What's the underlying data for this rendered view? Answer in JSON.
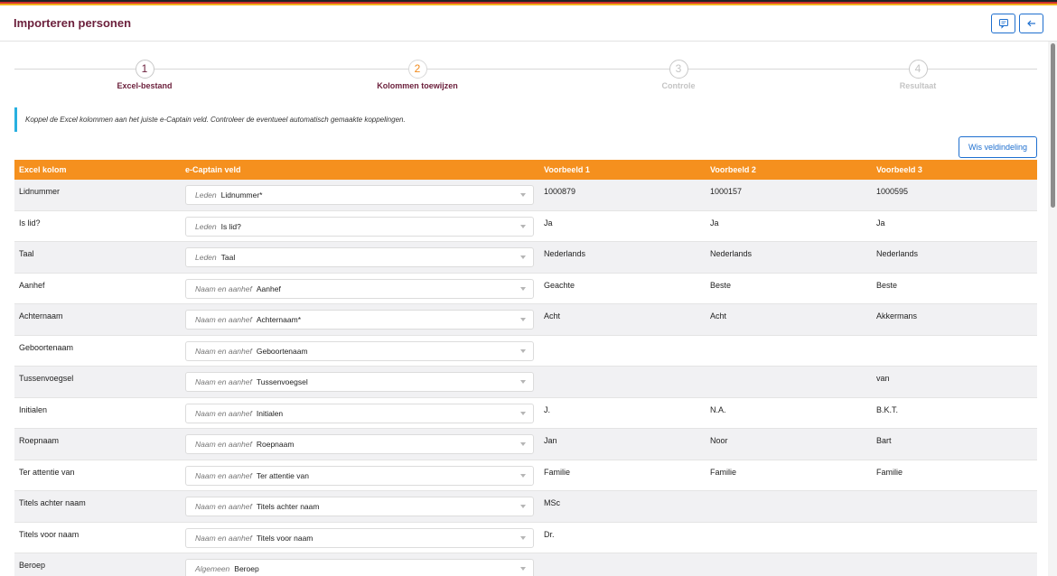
{
  "header": {
    "title": "Importeren personen"
  },
  "icons": {
    "comment": "comment-icon",
    "back": "arrow-left-icon"
  },
  "colors": {
    "accent": "#f5901e",
    "brand": "#6b1f3b",
    "link": "#1e6fcf",
    "info": "#28b0e0"
  },
  "steps": [
    {
      "num": "1",
      "label": "Excel-bestand",
      "state": "done"
    },
    {
      "num": "2",
      "label": "Kolommen toewijzen",
      "state": "active"
    },
    {
      "num": "3",
      "label": "Controle",
      "state": "inactive"
    },
    {
      "num": "4",
      "label": "Resultaat",
      "state": "inactive"
    }
  ],
  "info": "Koppel de Excel kolommen aan het juiste e-Captain veld. Controleer de eventueel automatisch gemaakte koppelingen.",
  "wis_button": "Wis veldindeling",
  "table": {
    "headers": [
      "Excel kolom",
      "e-Captain veld",
      "Voorbeeld 1",
      "Voorbeeld 2",
      "Voorbeeld 3"
    ],
    "rows": [
      {
        "col": "Lidnummer",
        "group": "Leden",
        "field": "Lidnummer*",
        "v1": "1000879",
        "v2": "1000157",
        "v3": "1000595"
      },
      {
        "col": "Is lid?",
        "group": "Leden",
        "field": "Is lid?",
        "v1": "Ja",
        "v2": "Ja",
        "v3": "Ja"
      },
      {
        "col": "Taal",
        "group": "Leden",
        "field": "Taal",
        "v1": "Nederlands",
        "v2": "Nederlands",
        "v3": "Nederlands"
      },
      {
        "col": "Aanhef",
        "group": "Naam en aanhef",
        "field": "Aanhef",
        "v1": "Geachte",
        "v2": "Beste",
        "v3": "Beste"
      },
      {
        "col": "Achternaam",
        "group": "Naam en aanhef",
        "field": "Achternaam*",
        "v1": "Acht",
        "v2": "Acht",
        "v3": "Akkermans"
      },
      {
        "col": "Geboortenaam",
        "group": "Naam en aanhef",
        "field": "Geboortenaam",
        "v1": "",
        "v2": "",
        "v3": ""
      },
      {
        "col": "Tussenvoegsel",
        "group": "Naam en aanhef",
        "field": "Tussenvoegsel",
        "v1": "",
        "v2": "",
        "v3": "van"
      },
      {
        "col": "Initialen",
        "group": "Naam en aanhef",
        "field": "Initialen",
        "v1": "J.",
        "v2": "N.A.",
        "v3": "B.K.T."
      },
      {
        "col": "Roepnaam",
        "group": "Naam en aanhef",
        "field": "Roepnaam",
        "v1": "Jan",
        "v2": "Noor",
        "v3": "Bart"
      },
      {
        "col": "Ter attentie van",
        "group": "Naam en aanhef",
        "field": "Ter attentie van",
        "v1": "Familie",
        "v2": "Familie",
        "v3": "Familie"
      },
      {
        "col": "Titels achter naam",
        "group": "Naam en aanhef",
        "field": "Titels achter naam",
        "v1": "MSc",
        "v2": "",
        "v3": ""
      },
      {
        "col": "Titels voor naam",
        "group": "Naam en aanhef",
        "field": "Titels voor naam",
        "v1": "Dr.",
        "v2": "",
        "v3": ""
      },
      {
        "col": "Beroep",
        "group": "Algemeen",
        "field": "Beroep",
        "v1": "",
        "v2": "",
        "v3": ""
      }
    ]
  }
}
